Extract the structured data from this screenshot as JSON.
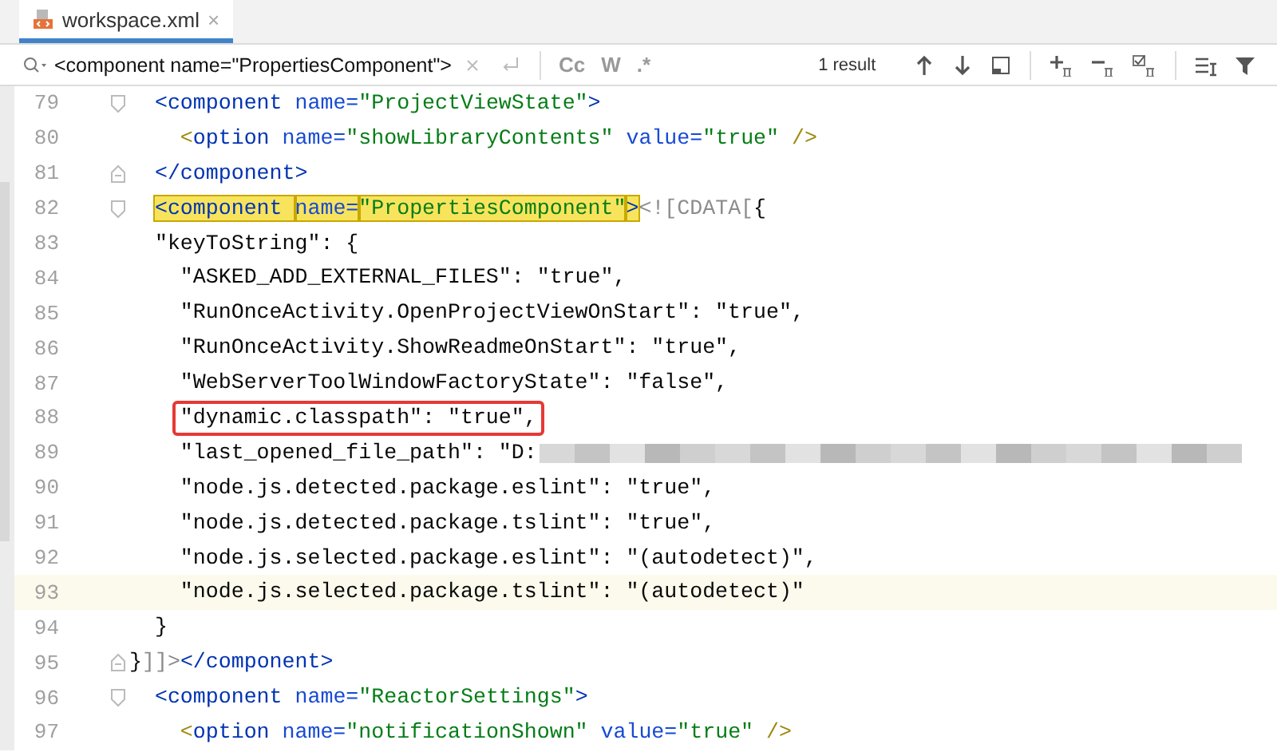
{
  "tabs": [
    {
      "label": "workspace.xml",
      "selected": true,
      "close": "×"
    }
  ],
  "search": {
    "value": "<component name=\"PropertiesComponent\">",
    "options": [
      "Cc",
      "W",
      ".*"
    ],
    "result": "1 result"
  },
  "lines": [
    {
      "num": "79",
      "kind": "fold-start",
      "current": false,
      "boxed": false,
      "redacted": false,
      "tokens": [
        {
          "t": "  <component ",
          "kind": "tag",
          "match": false
        },
        {
          "t": "name=",
          "kind": "attr",
          "match": false
        },
        {
          "t": "\"ProjectViewState\"",
          "kind": "str",
          "match": false
        },
        {
          "t": ">",
          "kind": "tag",
          "match": false
        }
      ]
    },
    {
      "num": "80",
      "kind": "plain",
      "current": false,
      "boxed": false,
      "redacted": false,
      "tokens": [
        {
          "t": "    <",
          "kind": "bracket",
          "match": false
        },
        {
          "t": "option ",
          "kind": "tag",
          "match": false
        },
        {
          "t": "name=",
          "kind": "attr",
          "match": false
        },
        {
          "t": "\"showLibraryContents\" ",
          "kind": "str",
          "match": false
        },
        {
          "t": "value=",
          "kind": "attr",
          "match": false
        },
        {
          "t": "\"true\" ",
          "kind": "str",
          "match": false
        },
        {
          "t": "/>",
          "kind": "bracket",
          "match": false
        }
      ]
    },
    {
      "num": "81",
      "kind": "fold-end",
      "current": false,
      "boxed": false,
      "redacted": false,
      "tokens": [
        {
          "t": "  </component>",
          "kind": "tag",
          "match": false
        }
      ]
    },
    {
      "num": "82",
      "kind": "fold-start",
      "current": false,
      "boxed": false,
      "redacted": false,
      "tokens": [
        {
          "t": "  <component ",
          "kind": "tag",
          "match": true
        },
        {
          "t": "name=",
          "kind": "attr",
          "match": true
        },
        {
          "t": "\"PropertiesComponent\"",
          "kind": "str",
          "match": true
        },
        {
          "t": ">",
          "kind": "tag",
          "match": true
        },
        {
          "t": "<![CDATA[",
          "kind": "cdata",
          "match": false
        },
        {
          "t": "{",
          "kind": "text",
          "match": false
        }
      ]
    },
    {
      "num": "83",
      "kind": "plain",
      "current": false,
      "boxed": false,
      "redacted": false,
      "tokens": [
        {
          "t": "  \"keyToString\": {",
          "kind": "text",
          "match": false
        }
      ]
    },
    {
      "num": "84",
      "kind": "plain",
      "current": false,
      "boxed": false,
      "redacted": false,
      "tokens": [
        {
          "t": "    \"ASKED_ADD_EXTERNAL_FILES\": \"true\",",
          "kind": "text",
          "match": false
        }
      ]
    },
    {
      "num": "85",
      "kind": "plain",
      "current": false,
      "boxed": false,
      "redacted": false,
      "tokens": [
        {
          "t": "    \"RunOnceActivity.OpenProjectViewOnStart\": \"true\",",
          "kind": "text",
          "match": false
        }
      ]
    },
    {
      "num": "86",
      "kind": "plain",
      "current": false,
      "boxed": false,
      "redacted": false,
      "tokens": [
        {
          "t": "    \"RunOnceActivity.ShowReadmeOnStart\": \"true\",",
          "kind": "text",
          "match": false
        }
      ]
    },
    {
      "num": "87",
      "kind": "plain",
      "current": false,
      "boxed": false,
      "redacted": false,
      "tokens": [
        {
          "t": "    \"WebServerToolWindowFactoryState\": \"false\",",
          "kind": "text",
          "match": false
        }
      ]
    },
    {
      "num": "88",
      "kind": "plain",
      "current": false,
      "boxed": true,
      "redacted": false,
      "tokens": [
        {
          "t": "    \"dynamic.classpath\": \"true\",",
          "kind": "text",
          "match": false
        }
      ]
    },
    {
      "num": "89",
      "kind": "plain",
      "current": false,
      "boxed": false,
      "redacted": true,
      "tokens": [
        {
          "t": "    \"last_opened_file_path\": \"D:",
          "kind": "text",
          "match": false
        }
      ]
    },
    {
      "num": "90",
      "kind": "plain",
      "current": false,
      "boxed": false,
      "redacted": false,
      "tokens": [
        {
          "t": "    \"node.js.detected.package.eslint\": \"true\",",
          "kind": "text",
          "match": false
        }
      ]
    },
    {
      "num": "91",
      "kind": "plain",
      "current": false,
      "boxed": false,
      "redacted": false,
      "tokens": [
        {
          "t": "    \"node.js.detected.package.tslint\": \"true\",",
          "kind": "text",
          "match": false
        }
      ]
    },
    {
      "num": "92",
      "kind": "plain",
      "current": false,
      "boxed": false,
      "redacted": false,
      "tokens": [
        {
          "t": "    \"node.js.selected.package.eslint\": \"(autodetect)\",",
          "kind": "text",
          "match": false
        }
      ]
    },
    {
      "num": "93",
      "kind": "plain",
      "current": true,
      "boxed": false,
      "redacted": false,
      "tokens": [
        {
          "t": "    \"node.js.selected.package.tslint\": \"(autodetect)\"",
          "kind": "text",
          "match": false
        }
      ]
    },
    {
      "num": "94",
      "kind": "plain",
      "current": false,
      "boxed": false,
      "redacted": false,
      "tokens": [
        {
          "t": "  }",
          "kind": "text",
          "match": false
        }
      ]
    },
    {
      "num": "95",
      "kind": "fold-end",
      "current": false,
      "boxed": false,
      "redacted": false,
      "tokens": [
        {
          "t": "}",
          "kind": "text",
          "match": false
        },
        {
          "t": "]]>",
          "kind": "cdata",
          "match": false
        },
        {
          "t": "</component>",
          "kind": "tag",
          "match": false
        }
      ]
    },
    {
      "num": "96",
      "kind": "fold-start",
      "current": false,
      "boxed": false,
      "redacted": false,
      "tokens": [
        {
          "t": "  <component ",
          "kind": "tag",
          "match": false
        },
        {
          "t": "name=",
          "kind": "attr",
          "match": false
        },
        {
          "t": "\"ReactorSettings\"",
          "kind": "str",
          "match": false
        },
        {
          "t": ">",
          "kind": "tag",
          "match": false
        }
      ]
    },
    {
      "num": "97",
      "kind": "plain",
      "current": false,
      "boxed": false,
      "redacted": false,
      "tokens": [
        {
          "t": "    <",
          "kind": "bracket",
          "match": false
        },
        {
          "t": "option ",
          "kind": "tag",
          "match": false
        },
        {
          "t": "name=",
          "kind": "attr",
          "match": false
        },
        {
          "t": "\"notificationShown\" ",
          "kind": "str",
          "match": false
        },
        {
          "t": "value=",
          "kind": "attr",
          "match": false
        },
        {
          "t": "\"true\" ",
          "kind": "str",
          "match": false
        },
        {
          "t": "/>",
          "kind": "bracket",
          "match": false
        }
      ]
    }
  ]
}
